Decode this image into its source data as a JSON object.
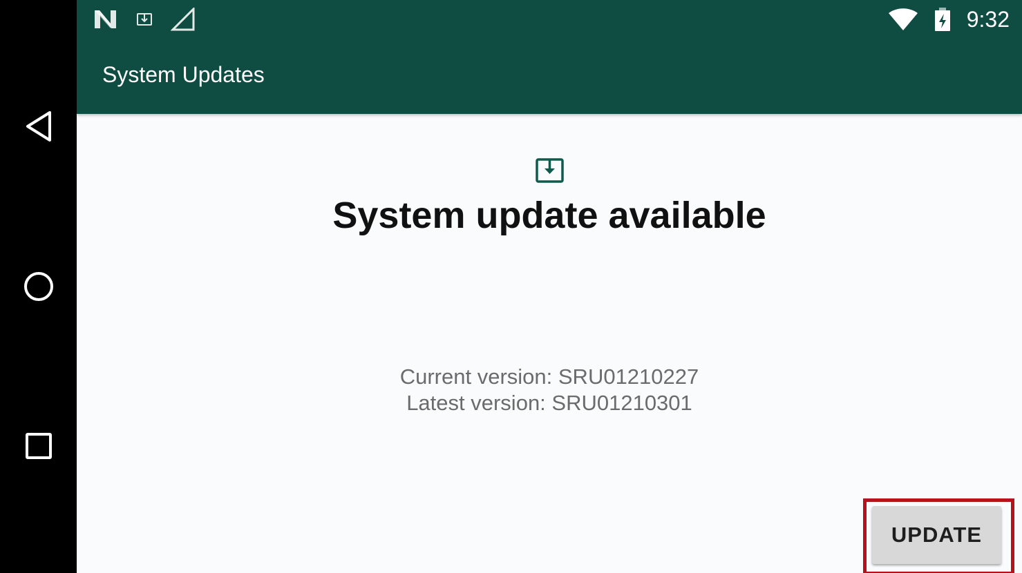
{
  "status_bar": {
    "icons_left": [
      "notification-n-icon",
      "system-update-icon",
      "cell-signal-icon"
    ],
    "icons_right": [
      "wifi-icon",
      "battery-charging-icon"
    ],
    "time": "9:32"
  },
  "app_bar": {
    "title": "System Updates",
    "color": "#0f4d43"
  },
  "main": {
    "icon": "system-update-icon",
    "headline": "System update available",
    "current_version": "Current version: SRU01210227",
    "latest_version": "Latest version: SRU01210301",
    "update_button_label": "UPDATE",
    "highlight_color": "#b5121b"
  },
  "nav_bar": {
    "buttons": [
      "back-icon",
      "home-icon",
      "recents-icon"
    ]
  }
}
